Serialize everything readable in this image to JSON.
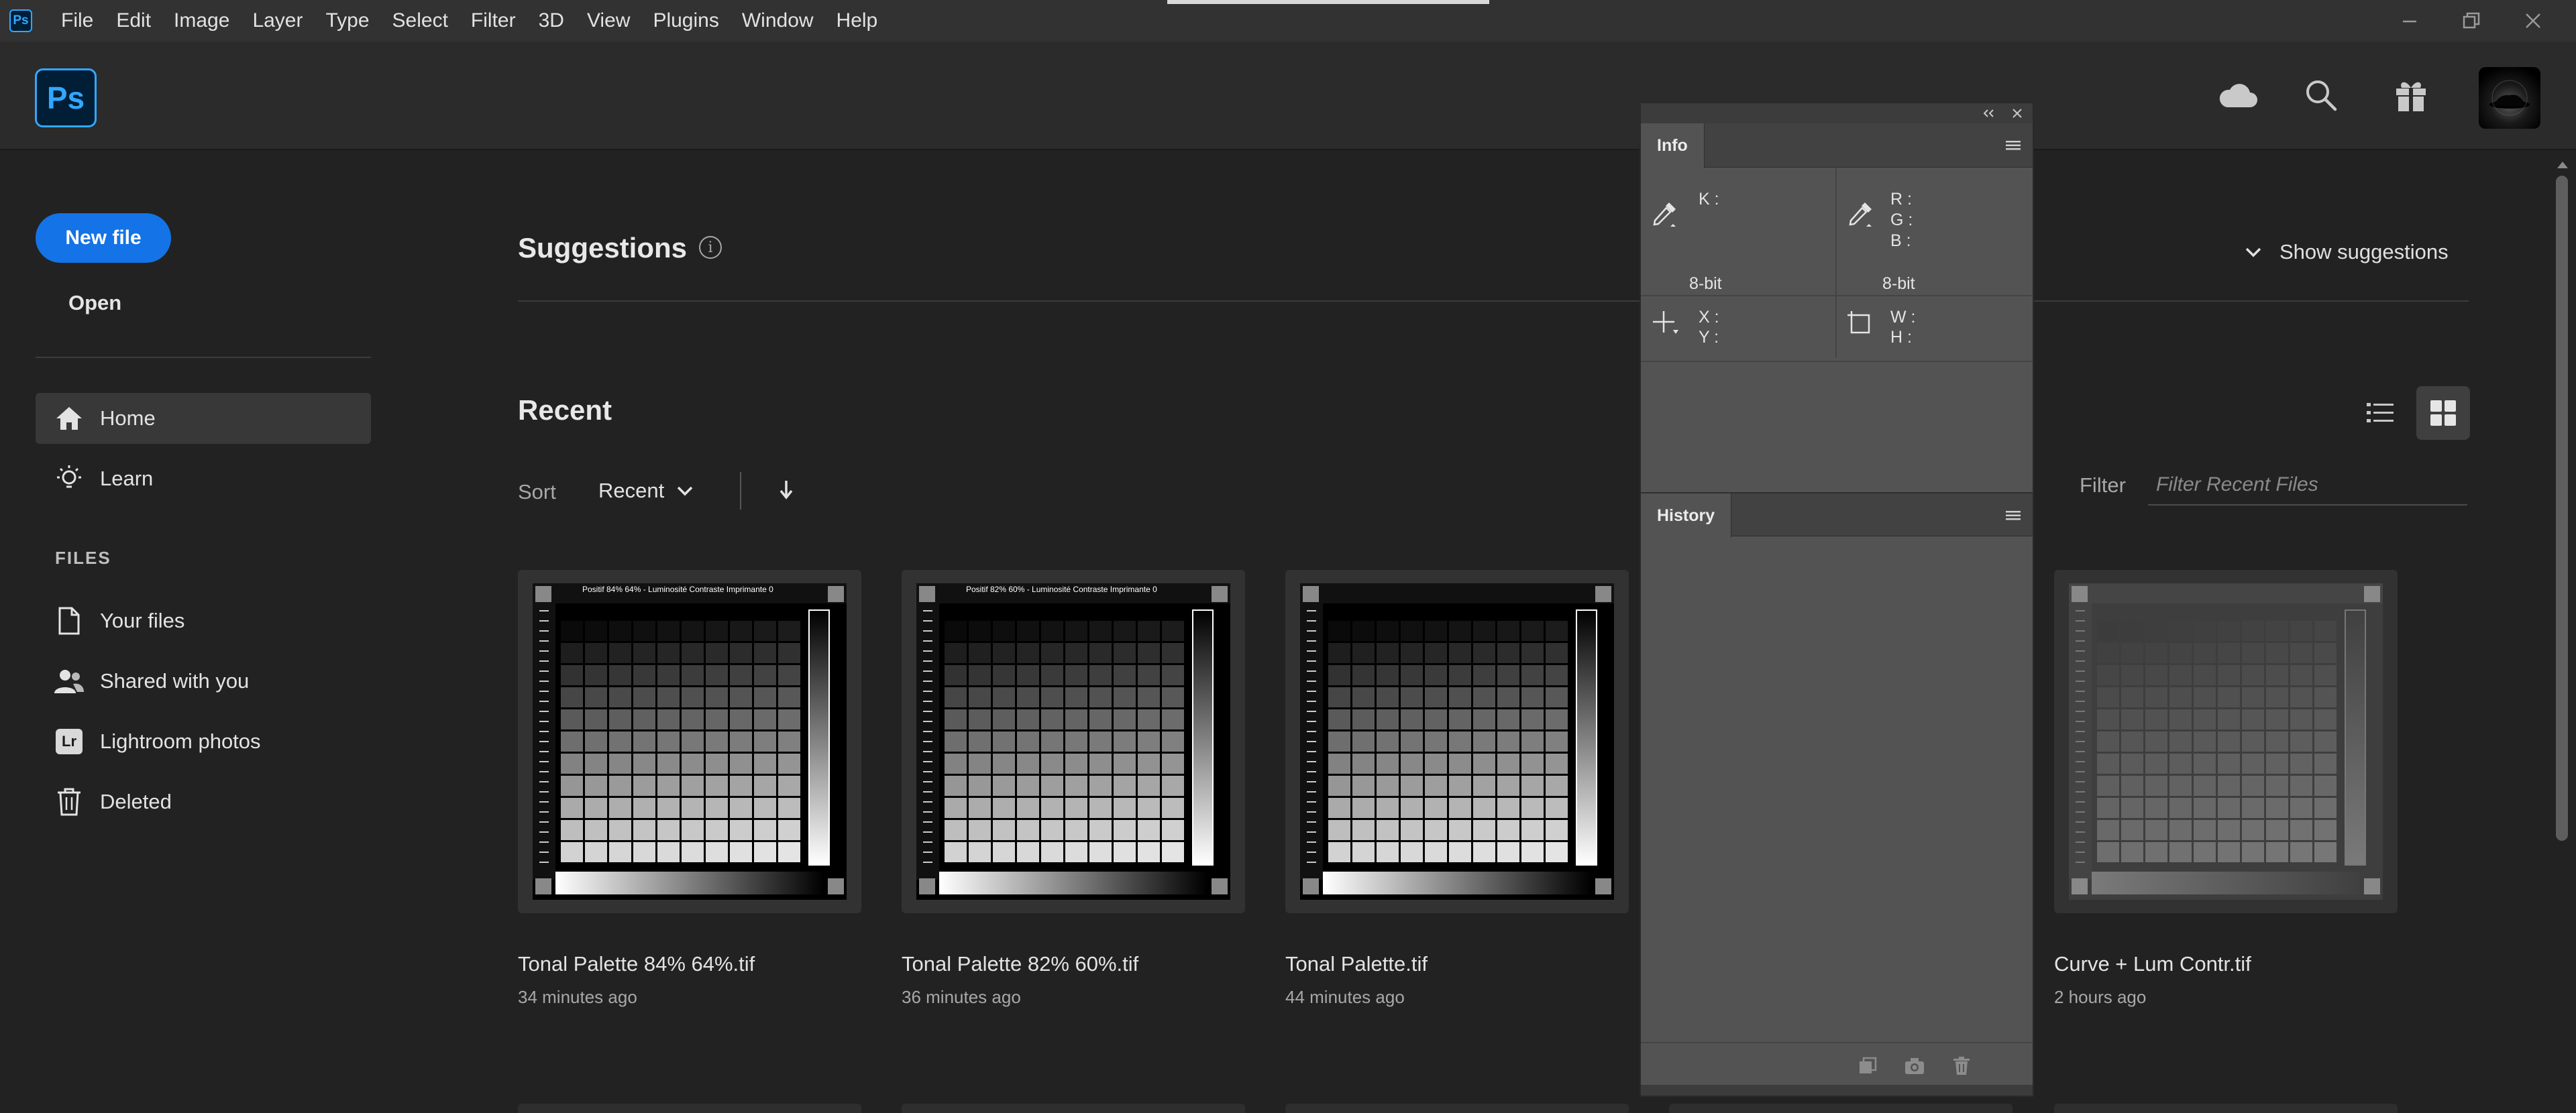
{
  "menubar": {
    "app_badge": "Ps",
    "items": [
      "File",
      "Edit",
      "Image",
      "Layer",
      "Type",
      "Select",
      "Filter",
      "3D",
      "View",
      "Plugins",
      "Window",
      "Help"
    ]
  },
  "header": {
    "logo": "Ps",
    "icons": [
      "cloud-icon",
      "search-icon",
      "gift-icon"
    ]
  },
  "sidebar": {
    "new_file": "New file",
    "open": "Open",
    "nav": [
      {
        "label": "Home",
        "icon": "home-icon",
        "active": true
      },
      {
        "label": "Learn",
        "icon": "lightbulb-icon",
        "active": false
      }
    ],
    "files_heading": "FILES",
    "files": [
      {
        "label": "Your files",
        "icon": "file-icon"
      },
      {
        "label": "Shared with you",
        "icon": "users-icon"
      },
      {
        "label": "Lightroom photos",
        "icon": "lightroom-icon",
        "badge": "Lr"
      },
      {
        "label": "Deleted",
        "icon": "trash-icon"
      }
    ]
  },
  "main": {
    "suggestions_title": "Suggestions",
    "info_glyph": "i",
    "show_suggestions": "Show suggestions",
    "recent_title": "Recent",
    "sort_label": "Sort",
    "sort_value": "Recent",
    "filter_label": "Filter",
    "filter_placeholder": "Filter Recent Files",
    "cards": [
      {
        "title": "Tonal Palette 84% 64%.tif",
        "time": "34 minutes ago",
        "caption": "Positif 84% 64% - Luminosité Contraste Imprimante 0"
      },
      {
        "title": "Tonal Palette 82% 60%.tif",
        "time": "36 minutes ago",
        "caption": "Positif 82% 60% - Luminosité Contraste Imprimante 0"
      },
      {
        "title": "Tonal Palette.tif",
        "time": "44 minutes ago",
        "caption": ""
      },
      {
        "title": "Curve + Lum Contr.tif",
        "time": "2 hours ago",
        "caption": ""
      }
    ]
  },
  "panel": {
    "info_tab": "Info",
    "history_tab": "History",
    "info": {
      "k_label": "K :",
      "r_label": "R :",
      "g_label": "G :",
      "b_label": "B :",
      "bit_left": "8-bit",
      "bit_right": "8-bit",
      "x_label": "X :",
      "y_label": "Y :",
      "w_label": "W :",
      "h_label": "H :"
    }
  },
  "colors": {
    "accent": "#1473e6",
    "ps_blue": "#31a8ff",
    "ps_dark": "#001e36",
    "panel_bg": "#535353",
    "app_bg": "#222222"
  }
}
